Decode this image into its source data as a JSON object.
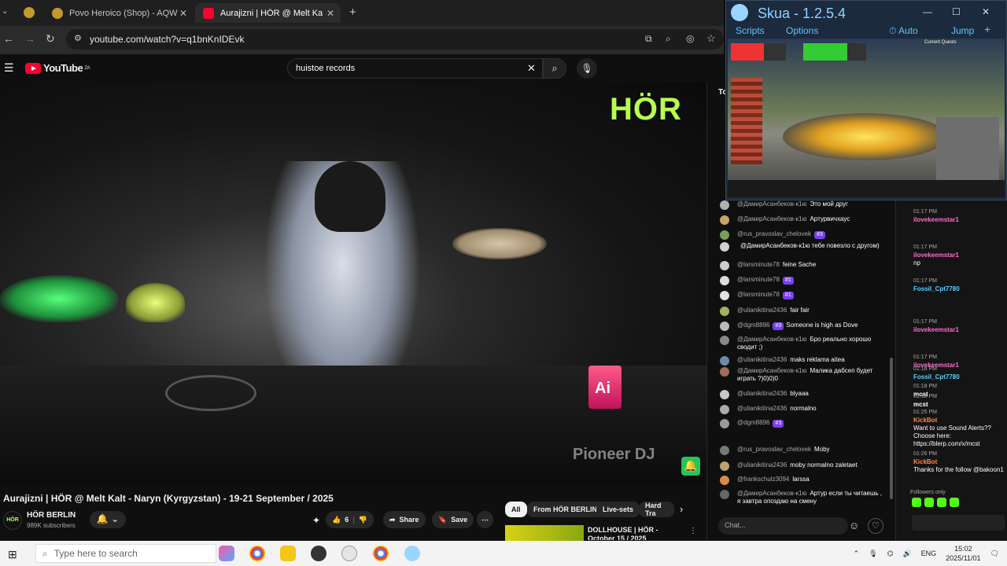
{
  "browser": {
    "tabs": [
      {
        "label": "Povo Heroico (Shop) - AQW",
        "active": false
      },
      {
        "label": "Aurajizni | HÖR @ Melt Kalt",
        "active": true
      }
    ],
    "url": "youtube.com/watch?v=q1bnKnIDEvk"
  },
  "youtube": {
    "logo_text": "YouTube",
    "logo_region": "ZA",
    "search_value": "huistoe records"
  },
  "video": {
    "watermark": "HÖR",
    "pioneer": "Pioneer DJ",
    "can_text": "Ai",
    "title": "Aurajizni | HÖR @ Melt Kalt - Naryn (Kyrgyzstan) - 19-21 September / 2025",
    "channel_name": "HÖR BERLIN",
    "channel_avatar": "HÖR",
    "subscribers": "989K subscribers",
    "likes": "6",
    "share_label": "Share",
    "save_label": "Save"
  },
  "chips": [
    "All",
    "From HÖR BERLIN",
    "Live-sets",
    "Hard Tra"
  ],
  "recommended": {
    "title": "DOLLHOUSE | HÖR - October 15 / 2025"
  },
  "live_chat": {
    "header_fragment": "To",
    "input_placeholder": "Chat...",
    "messages": [
      {
        "author": "@ДамирАсанбеков-к1ю",
        "text": "Это мой друг",
        "badge": ""
      },
      {
        "author": "@ДамирАсанбеков-к1ю",
        "text": "Артурвичхаус",
        "badge": ""
      },
      {
        "author": "@rus_pravoslav_chelovek",
        "text": "",
        "badge": "#3"
      },
      {
        "author": "",
        "text": "@ДамирАсанбеков-к1ю тебе повезло с другом)",
        "badge": ""
      },
      {
        "author": "@larsminute78",
        "text": "feine Sache",
        "badge": ""
      },
      {
        "author": "@larsminute78",
        "text": "",
        "badge": "#1"
      },
      {
        "author": "@larsminute78",
        "text": "",
        "badge": "#1"
      },
      {
        "author": "@ulianikitina2436",
        "text": "fair fair",
        "badge": ""
      },
      {
        "author": "@dgm8896",
        "text": "Someone is high as Dove",
        "badge": "#3"
      },
      {
        "author": "@ДамирАсанбеков-к1ю",
        "text": "Бро реально хорошо сводит ;)",
        "badge": ""
      },
      {
        "author": "@ulianikitina2436",
        "text": "maks reklama aitea",
        "badge": ""
      },
      {
        "author": "@ДамирАсанбеков-к1ю",
        "text": "Малика дабсеп будет играть ?)0)0)0",
        "badge": ""
      },
      {
        "author": "@ulianikitina2436",
        "text": "blyaaa",
        "badge": ""
      },
      {
        "author": "@ulianikitina2436",
        "text": "normalno",
        "badge": ""
      },
      {
        "author": "@dgm8896",
        "text": "",
        "badge": "#3"
      },
      {
        "author": "@rus_pravoslav_chelovek",
        "text": "Moby",
        "badge": ""
      },
      {
        "author": "@ulianikitina2436",
        "text": "moby normalno zaletaet",
        "badge": ""
      },
      {
        "author": "@frankschulz3094",
        "text": "larssa",
        "badge": ""
      },
      {
        "author": "@ДамирАсанбеков-к1ю",
        "text": "Артур если ты читаешь , я завтра опоздаю на смену",
        "badge": ""
      }
    ]
  },
  "skua": {
    "title": "Skua - 1.2.5.4",
    "menu": [
      "Scripts",
      "Options",
      "Auto",
      "Jump"
    ],
    "quests_title": "Current Quests"
  },
  "kick_chat": {
    "messages": [
      {
        "time": "01:17 PM",
        "name": "ilovekeemstar1",
        "text": ""
      },
      {
        "time": "01:17 PM",
        "name": "ilovekeemstar1",
        "text": "np"
      },
      {
        "time": "01:17 PM",
        "name": "Fossil_Cpt7780",
        "text": ""
      },
      {
        "time": "01:17 PM",
        "name": "ilovekeemstar1",
        "text": ""
      },
      {
        "time": "01:17 PM",
        "name": "ilovekeemstar1",
        "text": ""
      },
      {
        "time": "01:18 PM",
        "name": "Fossil_Cpt7780",
        "text": ""
      },
      {
        "time": "01:18 PM",
        "name": "mcst",
        "text": ""
      },
      {
        "time": "01:18 PM",
        "name": "mcst",
        "text": ""
      },
      {
        "time": "01:25 PM",
        "name": "KickBot",
        "text": "Want to use Sound Alerts?? Choose here: https://blerp.com/x/mcst"
      },
      {
        "time": "01:26 PM",
        "name": "KickBot",
        "text": "Thanks for the follow @bakoon1"
      }
    ],
    "followers_only": "Followers only"
  },
  "taskbar": {
    "search_placeholder": "Type here to search",
    "lang": "ENG",
    "time": "15:02",
    "date": "2025/11/01"
  },
  "colors": {
    "accent_green": "#b6ff4d",
    "kick_green": "#53fc18",
    "yt_red": "#ff0033"
  }
}
